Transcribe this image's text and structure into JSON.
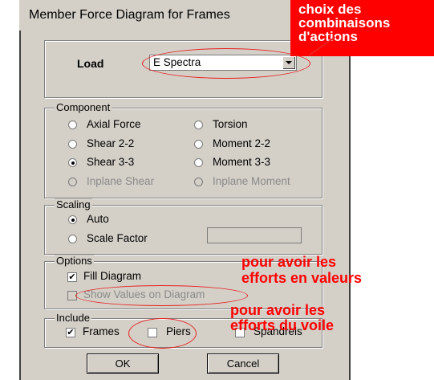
{
  "dialog": {
    "title": "Member Force Diagram for Frames",
    "load": {
      "label": "Load",
      "value": "E Spectra"
    },
    "component": {
      "group_label": "Component",
      "options": [
        {
          "label": "Axial Force",
          "selected": false,
          "enabled": true
        },
        {
          "label": "Torsion",
          "selected": false,
          "enabled": true
        },
        {
          "label": "Shear 2-2",
          "selected": false,
          "enabled": true
        },
        {
          "label": "Moment 2-2",
          "selected": false,
          "enabled": true
        },
        {
          "label": "Shear 3-3",
          "selected": true,
          "enabled": true
        },
        {
          "label": "Moment 3-3",
          "selected": false,
          "enabled": true
        },
        {
          "label": "Inplane Shear",
          "selected": false,
          "enabled": false
        },
        {
          "label": "Inplane Moment",
          "selected": false,
          "enabled": false
        }
      ]
    },
    "scaling": {
      "group_label": "Scaling",
      "auto_label": "Auto",
      "scale_factor_label": "Scale Factor",
      "scale_factor_value": ""
    },
    "options": {
      "group_label": "Options",
      "fill_diagram_label": "Fill Diagram",
      "fill_diagram_checked": true,
      "show_values_label": "Show Values on Diagram",
      "show_values_checked": false
    },
    "include": {
      "group_label": "Include",
      "frames_label": "Frames",
      "frames_checked": true,
      "piers_label": "Piers",
      "piers_checked": false,
      "spandrels_label": "Spandrels",
      "spandrels_checked": false
    },
    "buttons": {
      "ok": "OK",
      "cancel": "Cancel"
    }
  },
  "annotations": {
    "combinations": [
      "choix des",
      "combinaisons",
      "d'actions"
    ],
    "values": [
      "pour avoir les",
      "efforts en valeurs"
    ],
    "wall": [
      "pour avoir les",
      "efforts du voile"
    ]
  },
  "colors": {
    "dialog_bg": "#d4d0c8",
    "annotation_red": "#ff0000"
  }
}
